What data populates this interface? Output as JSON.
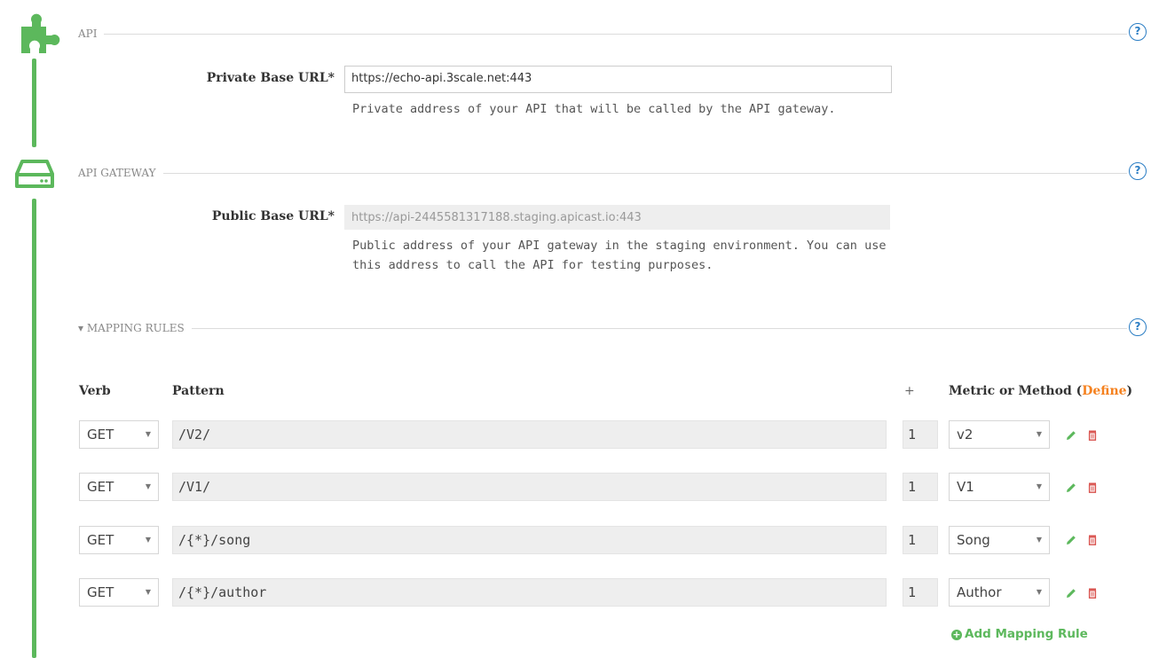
{
  "sections": {
    "api": {
      "title": "API",
      "private_base_url_label": "Private Base URL*",
      "private_base_url_value": "https://echo-api.3scale.net:443",
      "private_base_url_hint": "Private address of your API that will be called by the API gateway."
    },
    "gateway": {
      "title": "API GATEWAY",
      "public_base_url_label": "Public Base URL*",
      "public_base_url_value": "https://api-2445581317188.staging.apicast.io:443",
      "public_base_url_hint_line1": "Public address of your API gateway in the staging environment. You can use",
      "public_base_url_hint_line2": "this address to call the API for testing purposes."
    },
    "mapping": {
      "title": "▾ MAPPING RULES",
      "headers": {
        "verb": "Verb",
        "pattern": "Pattern",
        "delta": "+",
        "metric": "Metric or Method (",
        "define": "Define",
        "metric_close": ")"
      },
      "rows": [
        {
          "verb": "GET",
          "pattern": "/V2/",
          "delta": "1",
          "metric": "v2"
        },
        {
          "verb": "GET",
          "pattern": "/V1/",
          "delta": "1",
          "metric": "V1"
        },
        {
          "verb": "GET",
          "pattern": "/{*}/song",
          "delta": "1",
          "metric": "Song"
        },
        {
          "verb": "GET",
          "pattern": "/{*}/author",
          "delta": "1",
          "metric": "Author"
        }
      ],
      "add_rule_label": "Add Mapping Rule"
    }
  },
  "help_glyph": "?",
  "caret_glyph": "▼",
  "icons": [
    "puzzle-icon",
    "gateway-server-icon",
    "help-icon",
    "edit-pencil-icon",
    "delete-trash-icon",
    "plus-circle-icon"
  ],
  "colors": {
    "accent_green": "#5cb85c",
    "define_orange": "#f58220",
    "help_blue": "#2a7dc4",
    "delete_red": "#d9534f"
  }
}
